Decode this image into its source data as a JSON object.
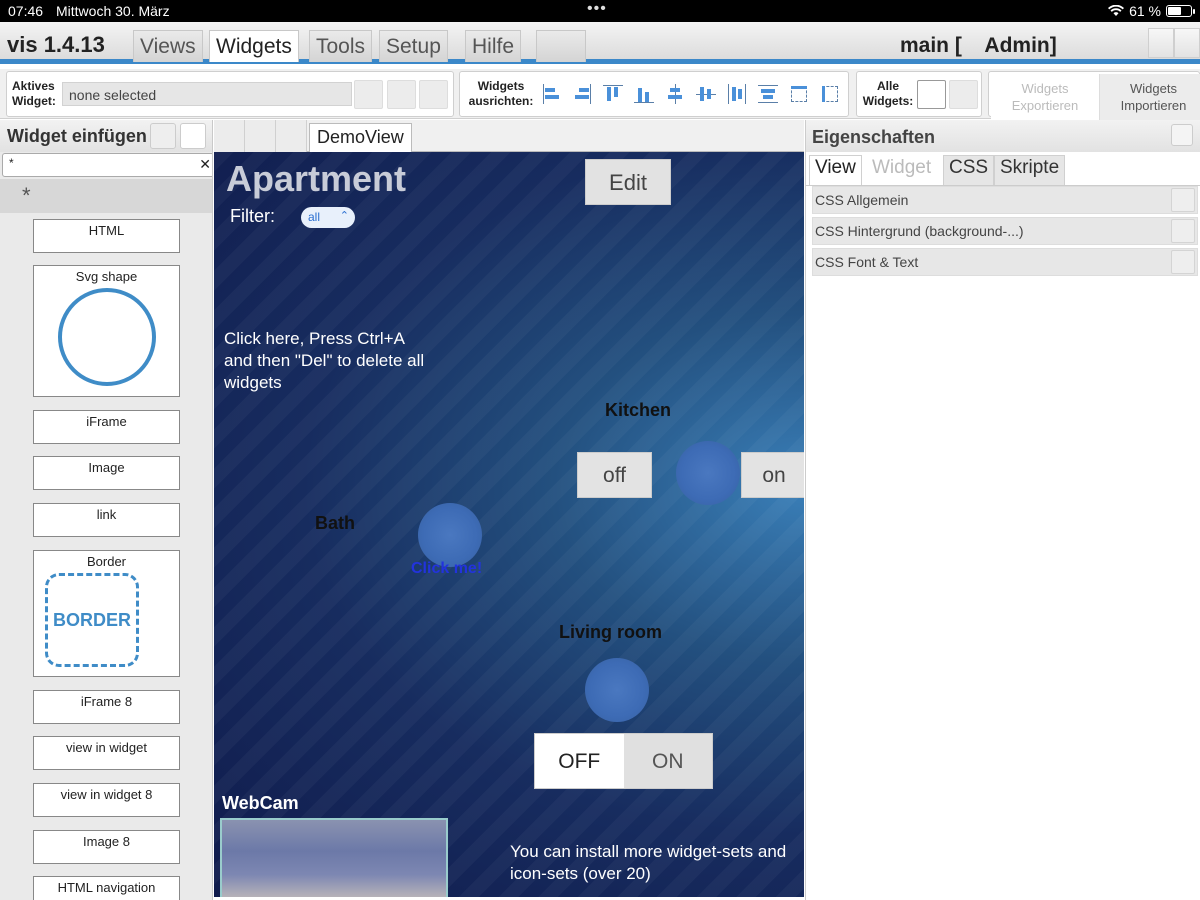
{
  "status_bar": {
    "time": "07:46",
    "date": "Mittwoch 30. März",
    "battery": "61 %",
    "battery_level": 0.61
  },
  "menubar": {
    "app_title": "vis 1.4.13",
    "tabs": [
      "Views",
      "Widgets",
      "Tools",
      "Setup",
      "Hilfe"
    ],
    "active_tab": "Widgets",
    "project": "main [    Admin]"
  },
  "toolbar": {
    "active_widget_label": "Aktives Widget:",
    "active_widget_value": "none selected",
    "align_label": "Widgets ausrichten:",
    "all_widgets_label": "Alle Widgets:",
    "export_label": "Widgets Exportieren",
    "import_label": "Widgets Importieren"
  },
  "left_panel": {
    "title": "Widget einfügen",
    "search_value": "*",
    "filter_value": "*",
    "widgets": [
      "HTML",
      "Svg shape",
      "iFrame",
      "Image",
      "link",
      "Border",
      "iFrame 8",
      "view in widget",
      "view in widget 8",
      "Image 8",
      "HTML navigation"
    ],
    "border_preview_text": "BORDER"
  },
  "center": {
    "view_tab": "DemoView",
    "title": "Apartment",
    "filter_label": "Filter:",
    "filter_value": "all",
    "edit_button": "Edit",
    "note": "Click here, Press Ctrl+A and then \"Del\" to delete all widgets",
    "kitchen_label": "Kitchen",
    "kitchen_off": "off",
    "kitchen_on": "on",
    "bath_label": "Bath",
    "bath_click": "Click me!",
    "living_label": "Living room",
    "toggle_off": "OFF",
    "toggle_on": "ON",
    "webcam_label": "WebCam",
    "install_note": "You can install more widget-sets and icon-sets (over 20)"
  },
  "right_panel": {
    "title": "Eigenschaften",
    "tabs": [
      "View",
      "Widget",
      "CSS",
      "Skripte"
    ],
    "active_tab": "View",
    "sections": [
      "CSS Allgemein",
      "CSS Hintergrund (background-...)",
      "CSS Font & Text"
    ]
  },
  "colors": {
    "accent": "#3b88c9",
    "canvas_dark": "#101b4c",
    "click_me": "#2233dd"
  }
}
